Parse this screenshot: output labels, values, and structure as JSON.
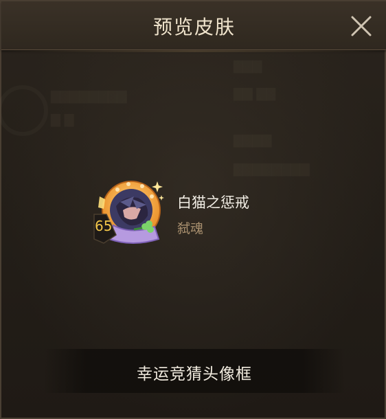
{
  "dialog": {
    "title": "预览皮肤",
    "close_icon": "close-icon"
  },
  "item": {
    "name": "白猫之惩戒",
    "type": "弑魂",
    "level": "65",
    "avatar_icon": "hooded-character-avatar-icon"
  },
  "footer": {
    "label": "幸运竞猜头像框"
  },
  "colors": {
    "background": "#221c16",
    "title_text": "#efe3cc",
    "item_type_text": "#a88f6e",
    "level_text": "#f2c64a",
    "avatar_ring": "#f1a13c"
  }
}
